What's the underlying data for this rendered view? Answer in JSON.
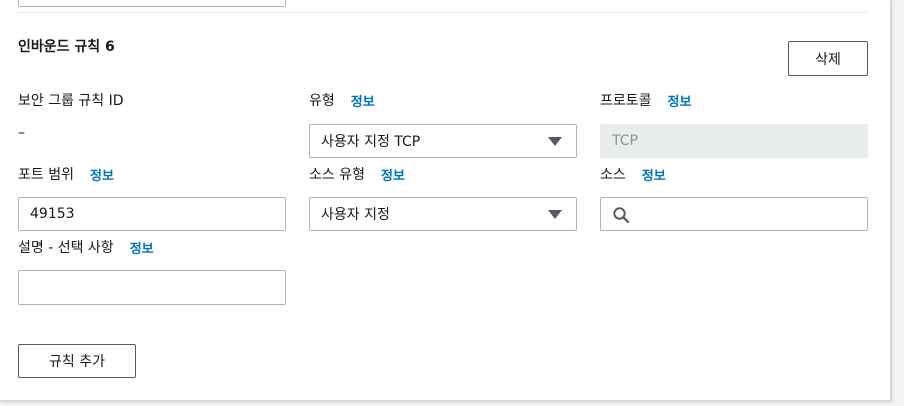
{
  "rule": {
    "title": "인바운드 규칙 6",
    "delete_label": "삭제"
  },
  "fields": {
    "security_group_rule_id": {
      "label": "보안 그룹 규칙 ID",
      "value": "–"
    },
    "type": {
      "label": "유형",
      "info": "정보",
      "value": "사용자 지정 TCP"
    },
    "protocol": {
      "label": "프로토콜",
      "info": "정보",
      "value": "TCP"
    },
    "port_range": {
      "label": "포트 범위",
      "info": "정보",
      "value": "49153"
    },
    "source_type": {
      "label": "소스 유형",
      "info": "정보",
      "value": "사용자 지정"
    },
    "source": {
      "label": "소스",
      "info": "정보",
      "value": ""
    },
    "description": {
      "label": "설명 - 선택 사항",
      "info": "정보",
      "value": ""
    }
  },
  "add_rule_label": "규칙 추가",
  "colors": {
    "link": "#0073bb",
    "border": "#aab7b8",
    "disabled_bg": "#eaeded"
  },
  "icons": {
    "dropdown": "caret-down-icon",
    "search": "search-icon"
  }
}
